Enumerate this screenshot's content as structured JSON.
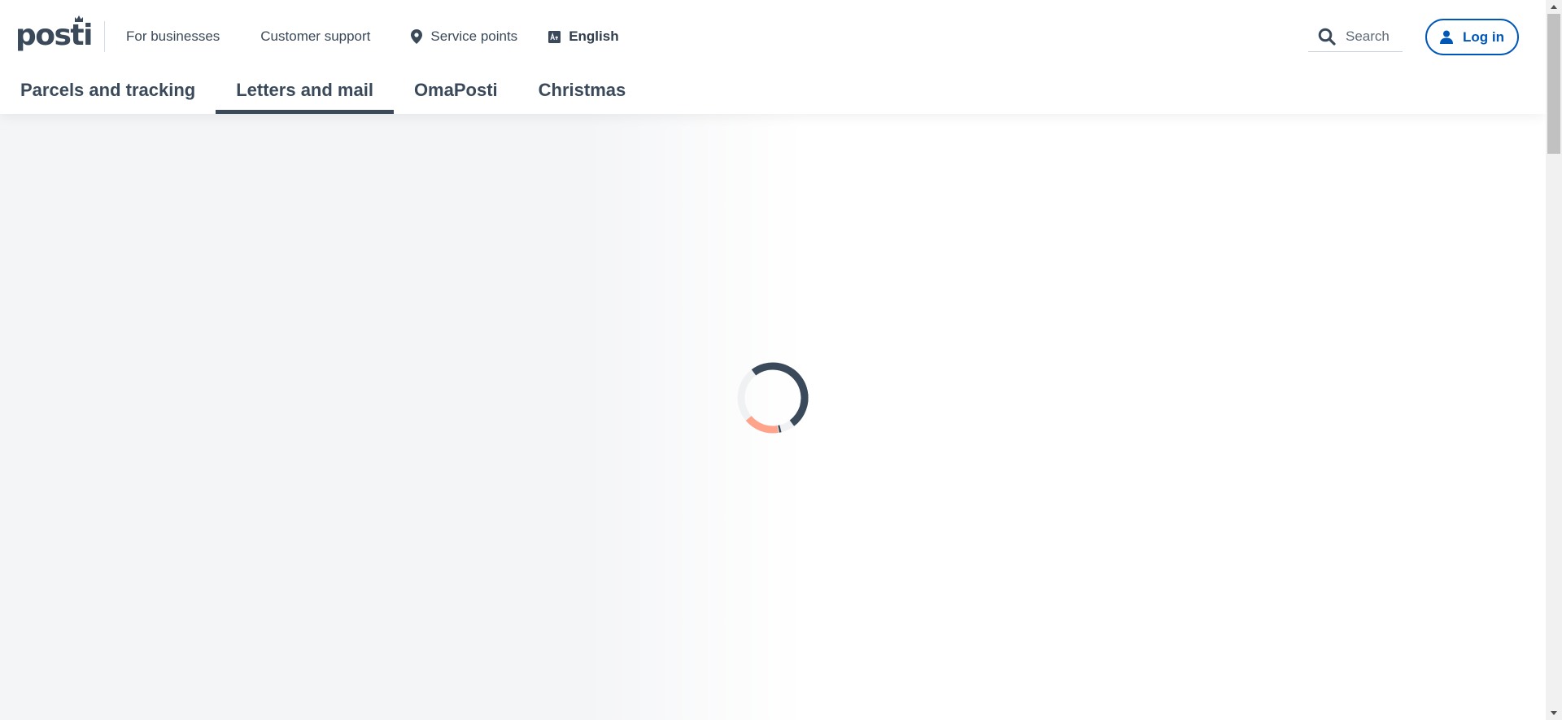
{
  "brand": {
    "logo_text": "posti"
  },
  "top_nav": {
    "for_businesses": "For businesses",
    "customer_support": "Customer support",
    "service_points": "Service points",
    "language": "English"
  },
  "search": {
    "placeholder": "Search"
  },
  "login": {
    "label": "Log in"
  },
  "main_nav": {
    "tabs": [
      {
        "label": "Parcels and tracking",
        "active": false
      },
      {
        "label": "Letters and mail",
        "active": true
      },
      {
        "label": "OmaPosti",
        "active": false
      },
      {
        "label": "Christmas",
        "active": false
      }
    ]
  },
  "colors": {
    "text": "#3b4a5a",
    "accent_blue": "#0057b8",
    "spinner_dark": "#3b4a5a",
    "spinner_orange": "#ffa38b",
    "spinner_light": "#f0f1f3"
  },
  "icons": {
    "service_points": "map-pin-icon",
    "language": "language-icon",
    "search": "search-icon",
    "login": "user-icon",
    "loading": "loading-spinner"
  }
}
